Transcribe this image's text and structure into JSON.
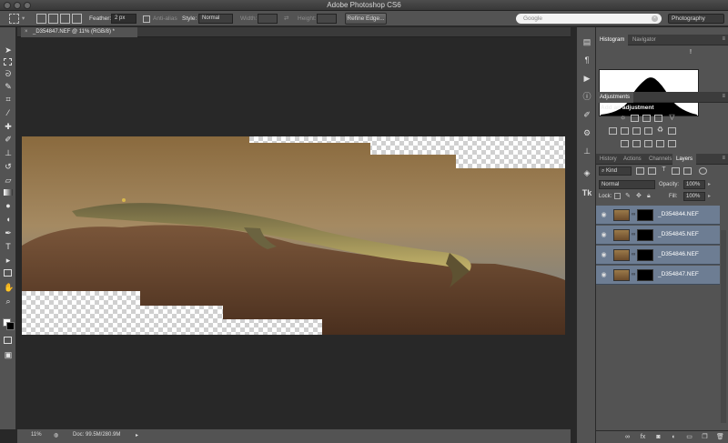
{
  "window": {
    "title": "Adobe Photoshop CS6"
  },
  "options_bar": {
    "feather_label": "Feather:",
    "feather_value": "2 px",
    "anti_alias_label": "Anti-alias",
    "style_label": "Style:",
    "style_value": "Normal",
    "width_label": "Width:",
    "height_label": "Height:",
    "refine_edge_label": "Refine Edge...",
    "search_placeholder": "Google",
    "workspace": "Photography"
  },
  "document": {
    "tab_title": "_D354847.NEF @ 11% (RGB/8) *",
    "zoom": "11%",
    "doc_size": "Doc: 99.5M/280.9M"
  },
  "panels": {
    "histogram_tabs": [
      "Histogram",
      "Navigator"
    ],
    "histogram_warning": "!",
    "adjustments_tab": "Adjustments",
    "adjustments_title": "Add an adjustment",
    "layer_tabs": [
      "History",
      "Actions",
      "Channels",
      "Layers"
    ],
    "kind_label": "Kind",
    "blend_mode": "Normal",
    "opacity_label": "Opacity:",
    "opacity_value": "100%",
    "lock_label": "Lock:",
    "fill_label": "Fill:",
    "fill_value": "100%"
  },
  "layers": [
    {
      "name": "_D354844.NEF",
      "visible": true
    },
    {
      "name": "_D354845.NEF",
      "visible": true
    },
    {
      "name": "_D354846.NEF",
      "visible": true
    },
    {
      "name": "_D354847.NEF",
      "visible": true
    }
  ],
  "colors": {
    "ui_dark": "#282828",
    "ui_panel": "#535353",
    "layer_selected": "#6d7d93",
    "foreground": "#ffffff",
    "background": "#000000"
  }
}
